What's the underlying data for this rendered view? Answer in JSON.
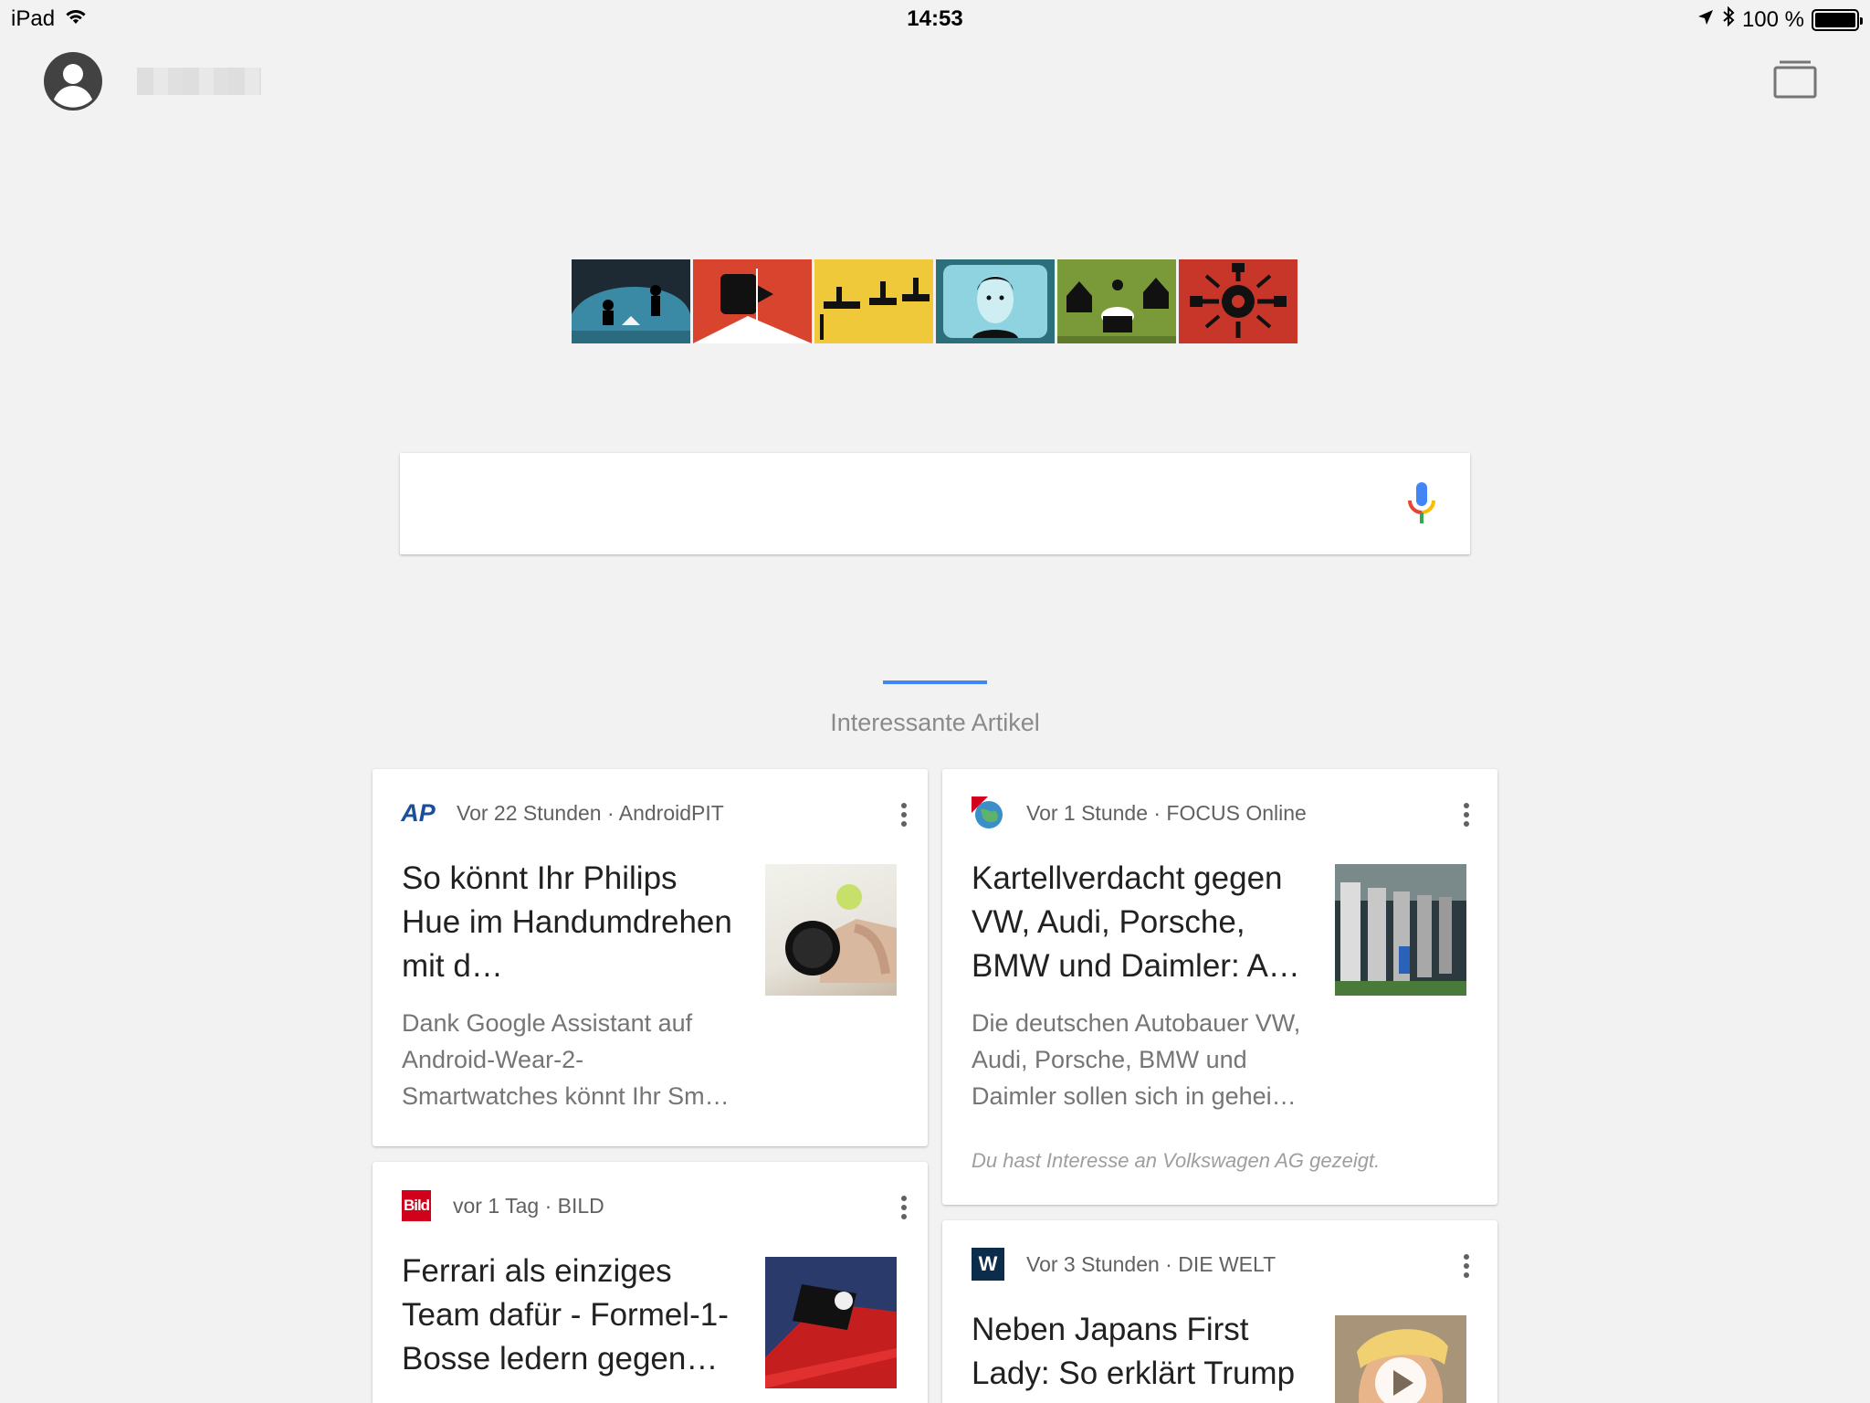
{
  "status_bar": {
    "device": "iPad",
    "time": "14:53",
    "battery_text": "100 %",
    "battery_level": 1.0
  },
  "header": {
    "account_name": ""
  },
  "search": {
    "placeholder": "",
    "value": ""
  },
  "section": {
    "title": "Interessante Artikel",
    "accent": "#4285f4"
  },
  "cards": [
    {
      "source_logo": "AP",
      "meta": "Vor 22 Stunden · AndroidPIT",
      "title": "So könnt Ihr Philips Hue im Handumdrehen mit d…",
      "snippet": "Dank Google Assistant auf Android-Wear-2-Smartwatches könnt Ihr Sm…"
    },
    {
      "source_logo": "focus-globe-icon",
      "meta": "Vor 1 Stunde · FOCUS Online",
      "title": "Kartellverdacht gegen VW, Audi, Porsche, BMW und Daimler: A…",
      "snippet": "Die deutschen Autobauer VW, Audi, Porsche, BMW und Daimler sollen sich in gehei…",
      "interest": "Du hast Interesse an Volkswagen AG gezeigt."
    },
    {
      "source_logo": "Bild",
      "meta": "vor 1 Tag · BILD",
      "title": "Ferrari als einziges Team dafür - Formel-1-Bosse ledern gegen…"
    },
    {
      "source_logo": "W",
      "meta": "Vor 3 Stunden · DIE WELT",
      "title": "Neben Japans First Lady: So erklärt Trump"
    }
  ],
  "colors": {
    "background": "#f2f2f2",
    "ap_blue": "#1a4f9c",
    "bild_red": "#d0021b",
    "welt_navy": "#0b2c4a"
  }
}
